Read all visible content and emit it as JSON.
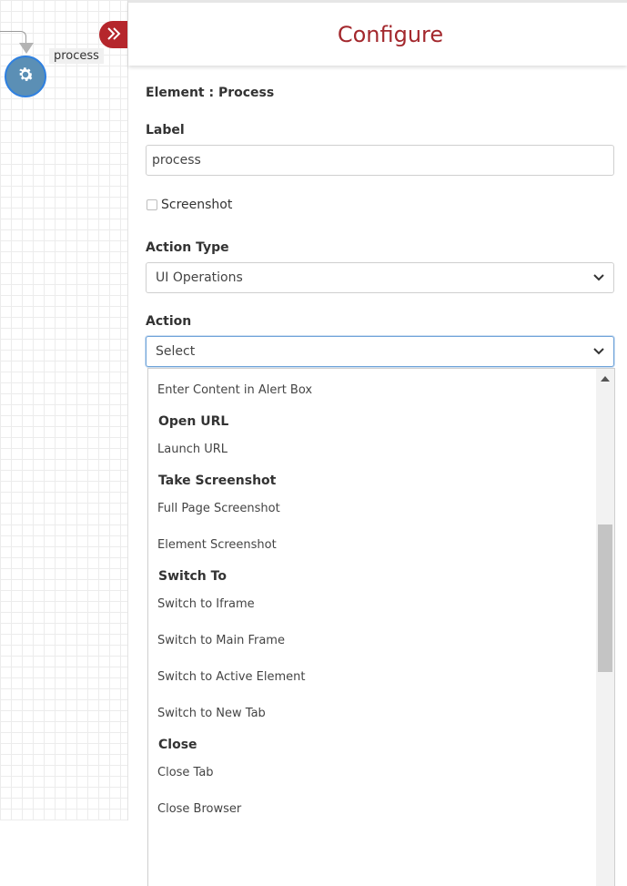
{
  "canvas": {
    "node_label": "process"
  },
  "panel": {
    "title": "Configure",
    "element_name": "Element : Process",
    "label_field": {
      "label": "Label",
      "value": "process"
    },
    "screenshot_checkbox": {
      "label": "Screenshot",
      "checked": false
    },
    "action_type": {
      "label": "Action Type",
      "selected": "UI Operations"
    },
    "action": {
      "label": "Action",
      "selected": "Select"
    },
    "dropdown_items": [
      {
        "kind": "option",
        "text": "Enter Content in Alert Box"
      },
      {
        "kind": "group",
        "text": "Open URL"
      },
      {
        "kind": "option",
        "text": "Launch URL"
      },
      {
        "kind": "group",
        "text": "Take Screenshot"
      },
      {
        "kind": "option",
        "text": "Full Page Screenshot"
      },
      {
        "kind": "option",
        "text": "Element Screenshot"
      },
      {
        "kind": "group",
        "text": "Switch To"
      },
      {
        "kind": "option",
        "text": "Switch to Iframe"
      },
      {
        "kind": "option",
        "text": "Switch to Main Frame"
      },
      {
        "kind": "option",
        "text": "Switch to Active Element"
      },
      {
        "kind": "option",
        "text": "Switch to New Tab"
      },
      {
        "kind": "group",
        "text": "Close"
      },
      {
        "kind": "option",
        "text": "Close Tab"
      },
      {
        "kind": "option",
        "text": "Close Browser"
      }
    ]
  },
  "icons": {
    "node": "gear-icon",
    "collapse": "double-chevron-right-icon",
    "select_arrow": "chevron-down-icon"
  },
  "colors": {
    "accent": "#a3282d",
    "collapse_button": "#b5262c",
    "node_fill": "#5b8fb5",
    "node_border": "#2f80e0",
    "focus_border": "#6fa3d9"
  }
}
